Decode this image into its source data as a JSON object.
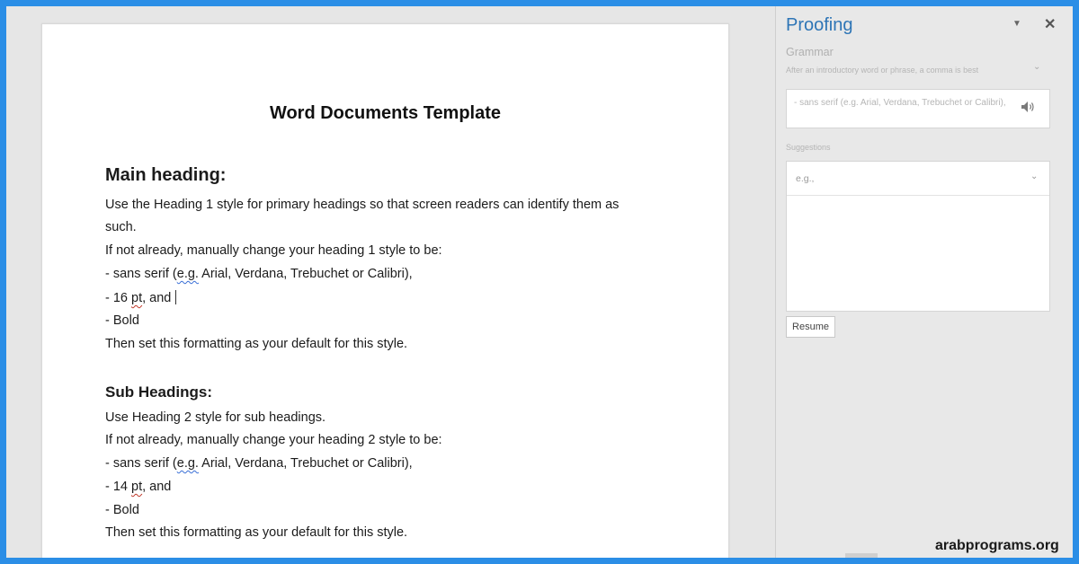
{
  "document": {
    "title": "Word Documents Template",
    "main_heading": "Main heading:",
    "main_lines": [
      "Use the Heading 1 style for primary headings so that screen readers can identify them as",
      "such.",
      "If not already, manually change your heading 1 style to be:",
      " - sans serif (",
      "e.g.",
      " Arial, Verdana, Trebuchet or Calibri),",
      " - 16 ",
      "pt",
      ", and",
      " - Bold",
      "Then set this formatting as your default for this style."
    ],
    "sub_heading": "Sub Headings:",
    "sub_lines": [
      "Use Heading 2 style for sub headings.",
      "If not already, manually change your heading 2 style to be:",
      " - sans serif (",
      "e.g.",
      " Arial, Verdana, Trebuchet or Calibri),",
      " - 14 ",
      "pt",
      ", and",
      " - Bold",
      "Then set this formatting as your default for this style."
    ]
  },
  "proofing": {
    "title": "Proofing",
    "section": "Grammar",
    "rule": "After an introductory word or phrase, a comma is best",
    "context": "- sans serif (e.g. Arial, Verdana, Trebuchet or Calibri),",
    "suggestions_label": "Suggestions",
    "suggestions": [
      "e.g.,"
    ],
    "resume_label": "Resume",
    "icons": {
      "menu": "dropdown-arrow-icon",
      "close": "close-icon",
      "speaker": "speaker-icon",
      "chevron": "chevron-down-icon"
    }
  },
  "watermark": "arabprograms.org",
  "colors": {
    "frame": "#2b8ee6",
    "pane_title": "#2e75b6",
    "spell_error": "#c0392b",
    "grammar_error": "#3a6fd6"
  }
}
